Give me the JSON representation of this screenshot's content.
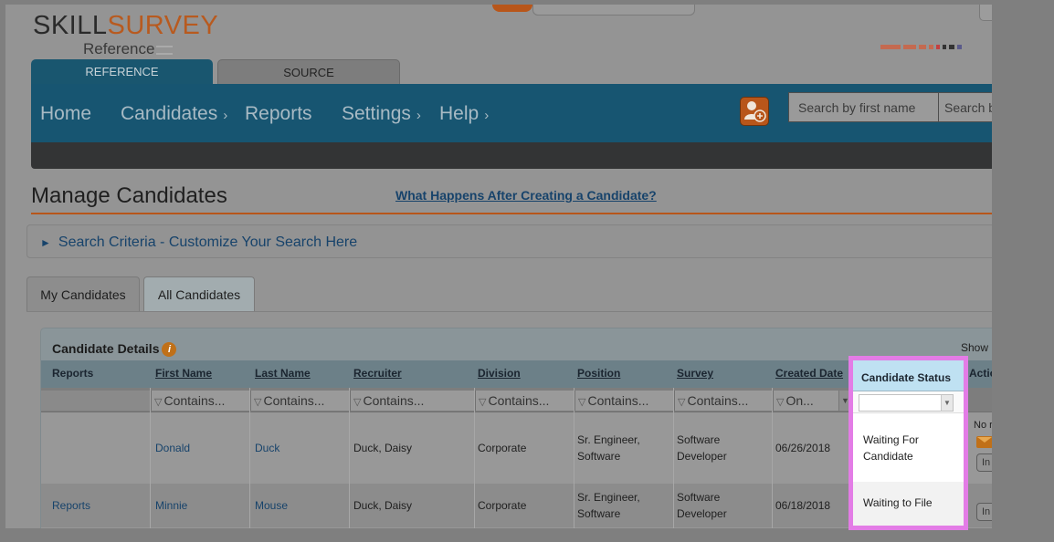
{
  "logo": {
    "brand_a": "SKILL",
    "brand_b": "SURVEY",
    "product": "Reference"
  },
  "product_tabs": {
    "reference": "REFERENCE",
    "source": "SOURCE"
  },
  "nav": {
    "home": "Home",
    "candidates": "Candidates",
    "reports": "Reports",
    "settings": "Settings",
    "help": "Help",
    "chevron": "›",
    "search_first_placeholder": "Search by first name",
    "search_last_placeholder": "Search by"
  },
  "page": {
    "title": "Manage Candidates",
    "help_link": "What Happens After Creating a Candidate?"
  },
  "criteria": {
    "arrow": "►",
    "label": "Search Criteria - Customize Your Search Here"
  },
  "tabs": {
    "my": "My Candidates",
    "all": "All Candidates"
  },
  "details": {
    "title": "Candidate Details",
    "info": "i",
    "show": "Show",
    "headers": {
      "reports": "Reports",
      "first_name": "First Name",
      "last_name": "Last Name",
      "recruiter": "Recruiter",
      "division": "Division",
      "position": "Position",
      "survey": "Survey",
      "created_date": "Created Date",
      "candidate_status": "Candidate Status",
      "actions": "Actio"
    },
    "filters": {
      "contains": "Contains...",
      "on": "On...",
      "funnel": "▽",
      "arrow": "▼"
    },
    "rows": [
      {
        "reports": "",
        "first_name": "Donald",
        "last_name": "Duck",
        "recruiter": "Duck, Daisy",
        "division": "Corporate",
        "position_l1": "Sr. Engineer,",
        "position_l2": "Software",
        "survey_l1": "Software",
        "survey_l2": "Developer",
        "created_date": "06/26/2018",
        "status_l1": "Waiting For",
        "status_l2": "Candidate",
        "action_note": "No re",
        "action_btn": "In P"
      },
      {
        "reports": "Reports",
        "first_name": "Minnie",
        "last_name": "Mouse",
        "recruiter": "Duck, Daisy",
        "division": "Corporate",
        "position_l1": "Sr. Engineer,",
        "position_l2": "Software",
        "survey_l1": "Software",
        "survey_l2": "Developer",
        "created_date": "06/18/2018",
        "status_l1": "Waiting to File",
        "action_btn": "In P"
      }
    ]
  },
  "colors": {
    "accent_orange": "#b8561a",
    "nav_blue": "#175571",
    "highlight_frame": "#e37ce6",
    "highlight_header": "#bfe1f2"
  },
  "icons": {
    "add_user": "add-user-icon",
    "info": "info-icon",
    "mail": "mail-icon",
    "filter": "funnel-icon"
  }
}
